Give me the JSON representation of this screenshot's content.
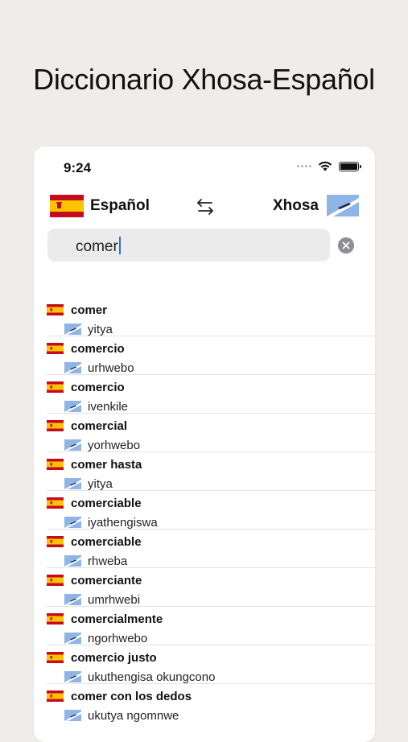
{
  "page": {
    "title": "Diccionario Xhosa-Español"
  },
  "status_bar": {
    "time": "9:24"
  },
  "languages": {
    "source_label": "Español",
    "target_label": "Xhosa",
    "source_flag_icon": "spain-flag-icon",
    "target_flag_icon": "xhosa-flag-icon"
  },
  "search": {
    "value": "comer"
  },
  "results": [
    {
      "es": "comer",
      "xh": "yitya"
    },
    {
      "es": "comercio",
      "xh": "urhwebo"
    },
    {
      "es": "comercio",
      "xh": "ivenkile"
    },
    {
      "es": "comercial",
      "xh": "yorhwebo"
    },
    {
      "es": "comer hasta",
      "xh": "yitya"
    },
    {
      "es": "comerciable",
      "xh": "iyathengiswa"
    },
    {
      "es": "comerciable",
      "xh": "rhweba"
    },
    {
      "es": "comerciante",
      "xh": "umrhwebi"
    },
    {
      "es": "comercialmente",
      "xh": "ngorhwebo"
    },
    {
      "es": "comercio justo",
      "xh": "ukuthengisa okungcono"
    },
    {
      "es": "comer con los dedos",
      "xh": "ukutya ngomnwe"
    }
  ],
  "colors": {
    "background": "#efedea",
    "spain_red": "#c60b1e",
    "spain_yellow": "#ffc400",
    "xhosa_blue": "#8fb4e6",
    "caret": "#2f6fe0"
  }
}
